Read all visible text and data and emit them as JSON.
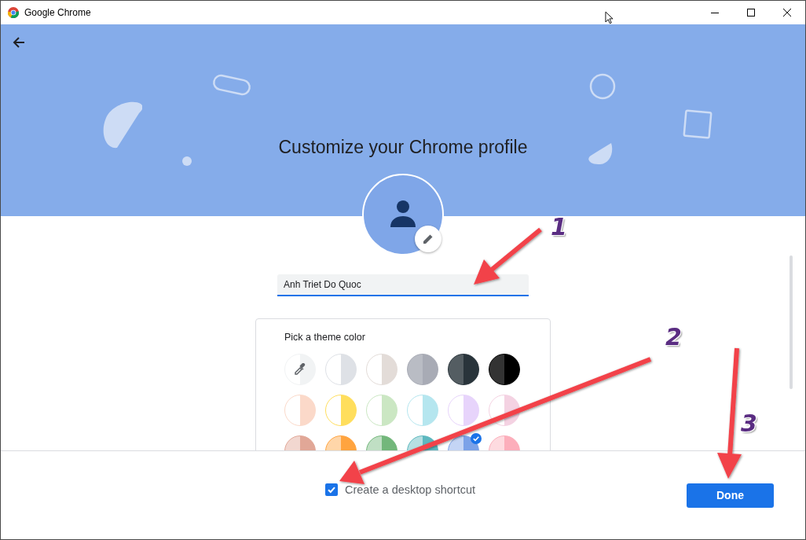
{
  "window": {
    "title": "Google Chrome"
  },
  "banner": {
    "title": "Customize your Chrome profile"
  },
  "name_field": {
    "value": "Anh Triet Do Quoc"
  },
  "theme_picker": {
    "title": "Pick a theme color",
    "swatches": [
      {
        "kind": "custom",
        "color": "#f1f3f4",
        "selected": false
      },
      {
        "kind": "split_white",
        "color": "#dee1e6",
        "selected": false
      },
      {
        "kind": "split_white",
        "color": "#e3dcd8",
        "selected": false
      },
      {
        "kind": "split_shade",
        "color": "#a8abb5",
        "selected": false
      },
      {
        "kind": "split_shade",
        "color": "#29343b",
        "selected": false
      },
      {
        "kind": "split_shade",
        "color": "#000000",
        "selected": false
      },
      {
        "kind": "split_white",
        "color": "#fbd9c9",
        "selected": false
      },
      {
        "kind": "split_white",
        "color": "#ffde5c",
        "selected": false
      },
      {
        "kind": "split_white",
        "color": "#cbe7c3",
        "selected": false
      },
      {
        "kind": "split_white",
        "color": "#b5e6ef",
        "selected": false
      },
      {
        "kind": "split_white",
        "color": "#e7d4fb",
        "selected": false
      },
      {
        "kind": "split_white",
        "color": "#f4d2e2",
        "selected": false
      },
      {
        "kind": "split_tint",
        "color": "#e1a797",
        "selected": false
      },
      {
        "kind": "split_tint",
        "color": "#ffa43f",
        "selected": false
      },
      {
        "kind": "split_tint",
        "color": "#73b77b",
        "selected": false
      },
      {
        "kind": "split_tint",
        "color": "#5db8bf",
        "selected": false
      },
      {
        "kind": "split_tint",
        "color": "#7ba2e8",
        "selected": true
      },
      {
        "kind": "split_tint",
        "color": "#fcaebb",
        "selected": false
      }
    ]
  },
  "footer": {
    "shortcut": {
      "label": "Create a desktop shortcut",
      "checked": true
    },
    "button": "Done"
  },
  "annotations": [
    {
      "label": "1"
    },
    {
      "label": "2"
    },
    {
      "label": "3"
    }
  ]
}
